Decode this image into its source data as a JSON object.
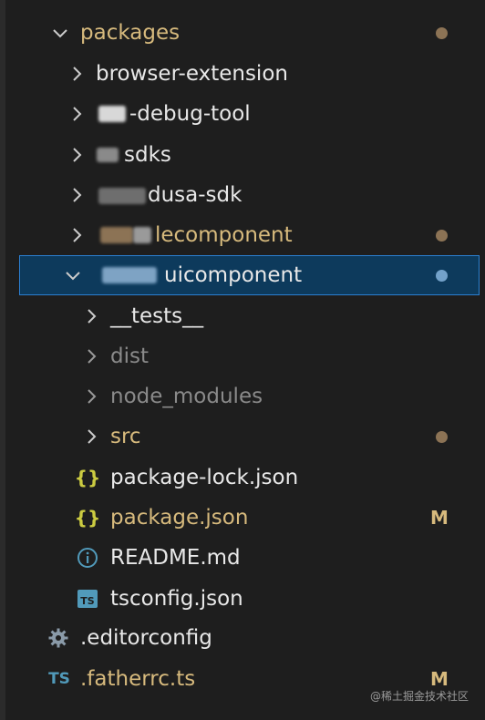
{
  "explorer": {
    "items": [
      {
        "label": "packages",
        "indicator": "dot"
      },
      {
        "label": "browser-extension"
      },
      {
        "label": "-debug-tool"
      },
      {
        "label": "sdks"
      },
      {
        "label": "dusa-sdk"
      },
      {
        "label": "lecomponent",
        "indicator": "dot"
      },
      {
        "label": "uicomponent",
        "indicator": "dot",
        "selected": true
      },
      {
        "label": "__tests__"
      },
      {
        "label": "dist"
      },
      {
        "label": "node_modules"
      },
      {
        "label": "src",
        "indicator": "dot"
      },
      {
        "label": "package-lock.json",
        "icon": "json-braces-icon"
      },
      {
        "label": "package.json",
        "icon": "json-braces-icon",
        "badge": "M"
      },
      {
        "label": "README.md",
        "icon": "info-icon"
      },
      {
        "label": "tsconfig.json",
        "icon": "ts-file-icon"
      },
      {
        "label": ".editorconfig",
        "icon": "gear-icon"
      },
      {
        "label": ".fatherrc.ts",
        "icon": "ts-file-icon",
        "badge": "M"
      }
    ]
  },
  "icons": {
    "ts_text": "TS",
    "json_text": "{}",
    "info_text": "i"
  },
  "watermark": "@稀土掘金技术社区",
  "colors": {
    "background": "#1e1e1e",
    "folder_text": "#d7ba7d",
    "selection_bg": "#0d3a5c",
    "selection_border": "#2b7fd1",
    "json_icon": "#cbcb41",
    "ts_icon": "#519aba",
    "info_icon": "#519aba"
  }
}
